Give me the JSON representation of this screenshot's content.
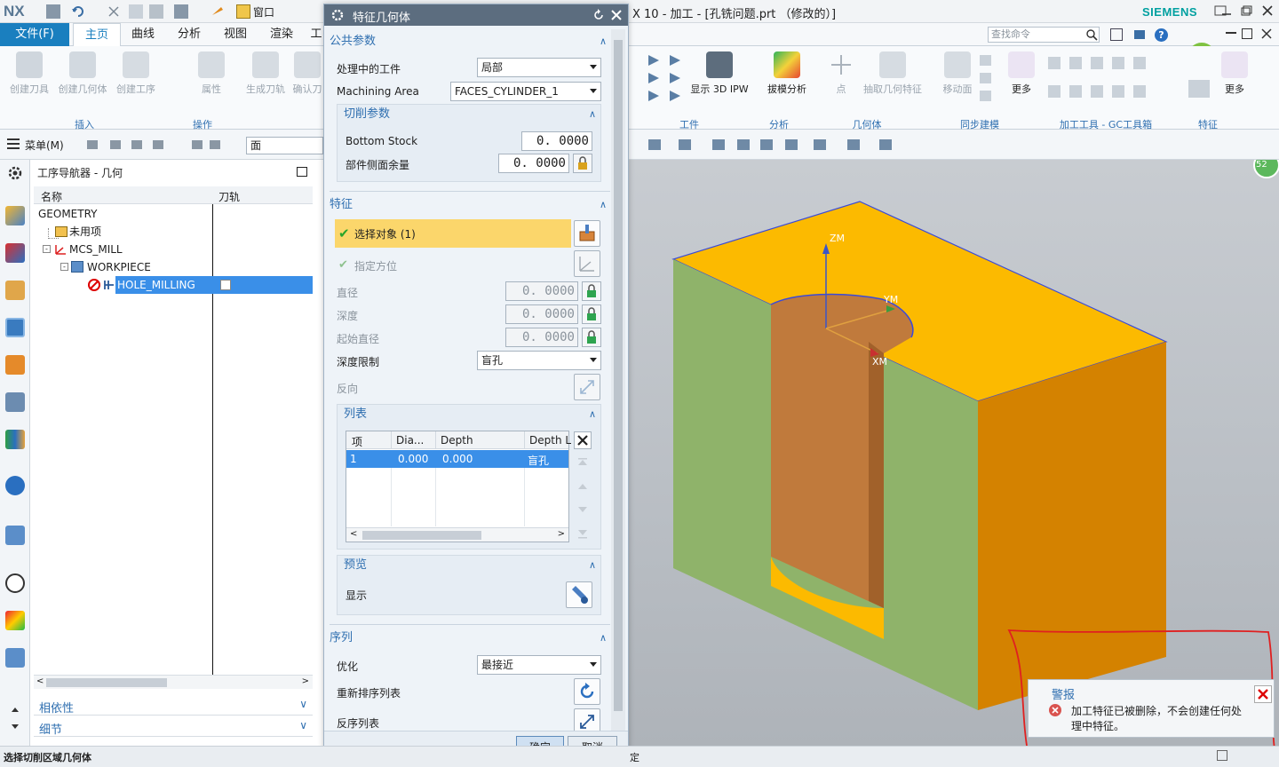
{
  "app": {
    "logo": "NX",
    "window_menu": "窗口",
    "title": "X 10 - 加工 - [孔铣问题.prt （修改的）]",
    "brand": "SIEMENS",
    "brand_color": "#00a0a0",
    "search_placeholder": "查找命令"
  },
  "ribbon": {
    "tabs": [
      "文件(F)",
      "主页",
      "曲线",
      "分析",
      "视图",
      "渲染",
      "工"
    ],
    "active_tab": "主页",
    "left_buttons": [
      "创建刀具",
      "创建几何体",
      "创建工序",
      "属性",
      "生成刀轨",
      "确认刀"
    ],
    "left_groups": [
      "插入",
      "操作"
    ],
    "right_buttons": [
      "显示 3D IPW",
      "拔模分析",
      "点",
      "抽取几何特征",
      "移动面",
      "更多",
      "更多"
    ],
    "right_groups": [
      "工件",
      "分析",
      "几何体",
      "同步建模",
      "加工工具 - GC工具箱",
      "特征"
    ]
  },
  "toolbar": {
    "menu_label": "菜单(M)",
    "filter_value": "面"
  },
  "navigator": {
    "title": "工序导航器 - 几何",
    "col_name": "名称",
    "col_path": "刀轨",
    "rows": [
      {
        "label": "GEOMETRY"
      },
      {
        "label": "未用项"
      },
      {
        "label": "MCS_MILL"
      },
      {
        "label": "WORKPIECE"
      },
      {
        "label": "HOLE_MILLING"
      }
    ],
    "panel_dependencies": "相依性",
    "panel_details": "细节"
  },
  "dialog": {
    "title": "特征几何体",
    "common_section": "公共参数",
    "in_process_label": "处理中的工件",
    "in_process_value": "局部",
    "machining_area_label": "Machining Area",
    "machining_area_value": "FACES_CYLINDER_1",
    "cut_params_section": "切削参数",
    "bottom_stock_label": "Bottom Stock",
    "bottom_stock_value": "0. 0000",
    "side_stock_label": "部件侧面余量",
    "side_stock_value": "0. 0000",
    "feature_section": "特征",
    "select_object_label": "选择对象 (1)",
    "specify_orient_label": "指定方位",
    "diameter_label": "直径",
    "diameter_value": "0. 0000",
    "depth_label": "深度",
    "depth_value": "0. 0000",
    "start_diameter_label": "起始直径",
    "start_diameter_value": "0. 0000",
    "depth_limit_label": "深度限制",
    "depth_limit_value": "盲孔",
    "reverse_label": "反向",
    "list_section": "列表",
    "list_columns": [
      "项",
      "Dia...",
      "Depth",
      "Depth L"
    ],
    "list_rows": [
      {
        "item": "1",
        "dia": "0.000",
        "depth": "0.000",
        "limit": "盲孔"
      }
    ],
    "preview_section": "预览",
    "display_label": "显示",
    "sequence_section": "序列",
    "optimize_label": "优化",
    "optimize_value": "最接近",
    "reorder_label": "重新排序列表",
    "reverse_list_label": "反序列表",
    "ok_label": "确定",
    "cancel_label": "取消"
  },
  "viewport": {
    "axis_z": "ZM",
    "axis_y": "YM",
    "axis_x": "XM",
    "badge": "52",
    "colors": {
      "top": "#fcba00",
      "side_left": "#8fb36a",
      "side_right": "#d48200",
      "hole": "#c07a3c"
    }
  },
  "alert": {
    "title": "警报",
    "message": "加工特征已被删除，不会创建任何处理中特征。"
  },
  "status": {
    "left_text": "选择切削区域几何体",
    "right_text": "定"
  }
}
